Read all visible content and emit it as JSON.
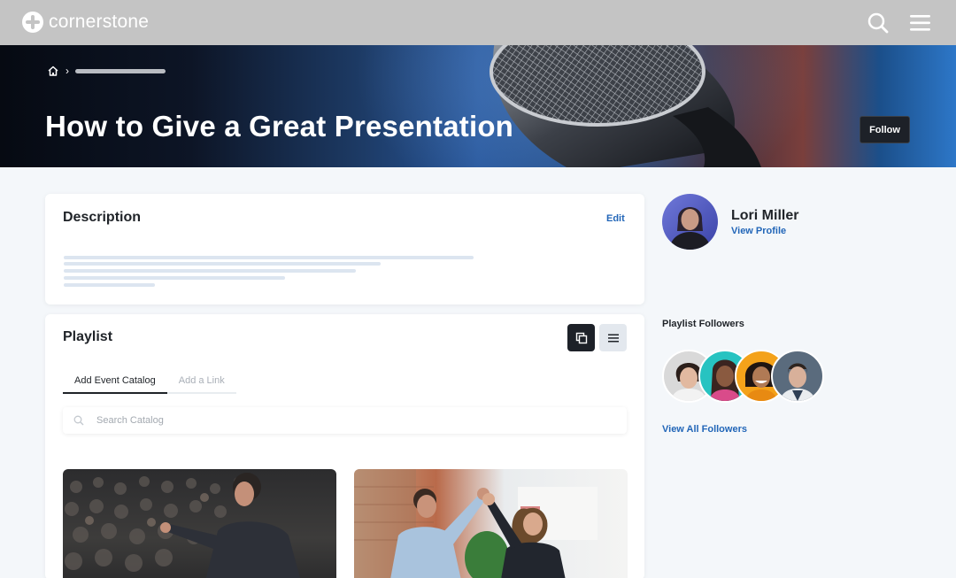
{
  "header": {
    "brand": "cornerstone",
    "icons": [
      "cornerstone-logo-icon",
      "search-icon",
      "menu-icon"
    ]
  },
  "hero": {
    "title": "How to Give a Great Presentation",
    "follow_label": "Follow",
    "breadcrumb_icons": [
      "home-icon",
      "chevron-right-icon"
    ]
  },
  "description": {
    "title": "Description",
    "edit_label": "Edit"
  },
  "playlist": {
    "title": "Playlist",
    "tabs": [
      {
        "label": "Add Event Catalog",
        "active": true
      },
      {
        "label": "Add a Link",
        "active": false
      }
    ],
    "search": {
      "placeholder": "Search Catalog",
      "value": ""
    },
    "view_modes": [
      "grid-view-icon",
      "list-view-icon"
    ],
    "items": [
      {
        "thumbnail": "speaker-audience-photo"
      },
      {
        "thumbnail": "high-five-photo"
      }
    ]
  },
  "author": {
    "name": "Lori Miller",
    "profile_link": "View Profile"
  },
  "followers": {
    "title": "Playlist Followers",
    "view_all": "View All Followers"
  },
  "colors": {
    "accent_link": "#2266b8",
    "dark_button": "#1d2128",
    "topbar": "#c4c4c4"
  }
}
